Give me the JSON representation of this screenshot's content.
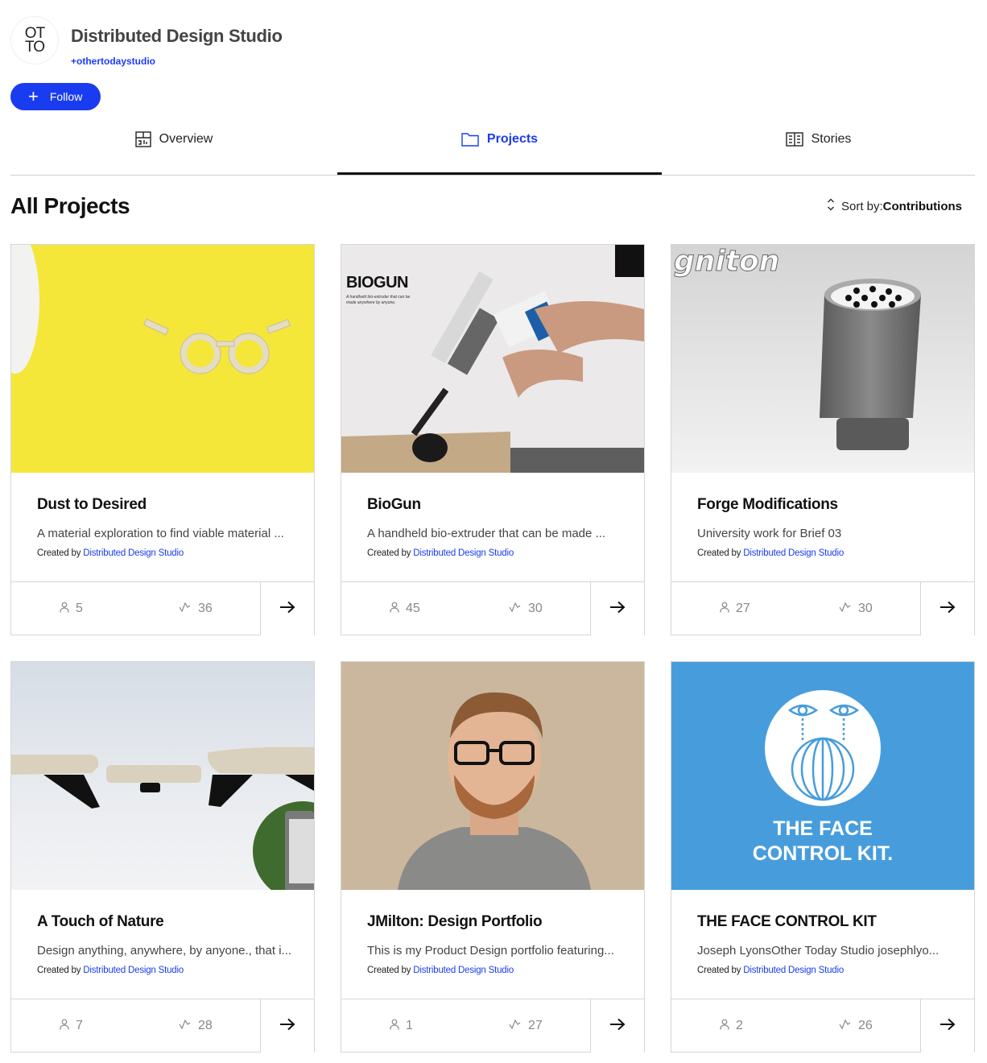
{
  "org": {
    "avatar_text": "OT\nTO",
    "name": "Distributed Design Studio",
    "handle": "+othertodaystudio",
    "follow_label": "Follow"
  },
  "tabs": [
    {
      "label": "Overview",
      "icon": "dashboard-icon",
      "active": false
    },
    {
      "label": "Projects",
      "icon": "folder-icon",
      "active": true
    },
    {
      "label": "Stories",
      "icon": "book-icon",
      "active": false
    }
  ],
  "section": {
    "title": "All Projects",
    "sort_prefix": "Sort by:",
    "sort_value": "Contributions"
  },
  "colors": {
    "accent": "#1a3cf0",
    "face_kit_blue": "#479ddc",
    "dust_yellow": "#f5e63a"
  },
  "projects": [
    {
      "title": "Dust to Desired",
      "description": "A material exploration to find viable material ...",
      "created_by_label": "Created by",
      "creator": "Distributed Design Studio",
      "members": "5",
      "contributions": "36",
      "image": "yellow-glasses-photo"
    },
    {
      "title": "BioGun",
      "description": "A handheld bio-extruder that can be made ...",
      "created_by_label": "Created by",
      "creator": "Distributed Design Studio",
      "members": "45",
      "contributions": "30",
      "image": "biogun-photo",
      "image_heading": "BIOGUN",
      "image_caption": "A handheld bio-extruder that can be made anywhere by anyone."
    },
    {
      "title": "Forge Modifications",
      "description": "University work for Brief 03",
      "created_by_label": "Created by",
      "creator": "Distributed Design Studio",
      "members": "27",
      "contributions": "30",
      "image": "gniton-render",
      "image_heading": "gniton"
    },
    {
      "title": "A Touch of Nature",
      "description": "Design anything, anywhere, by anyone., that i...",
      "created_by_label": "Created by",
      "creator": "Distributed Design Studio",
      "members": "7",
      "contributions": "28",
      "image": "modular-tables-photo"
    },
    {
      "title": "JMilton: Design Portfolio",
      "description": "This is my Product Design portfolio featuring...",
      "created_by_label": "Created by",
      "creator": "Distributed Design Studio",
      "members": "1",
      "contributions": "27",
      "image": "portrait-photo"
    },
    {
      "title": "THE FACE CONTROL KIT",
      "description": "Joseph LyonsOther Today Studio josephlyo...",
      "created_by_label": "Created by",
      "creator": "Distributed Design Studio",
      "members": "2",
      "contributions": "26",
      "image": "face-control-kit-poster",
      "image_heading_1": "THE FACE",
      "image_heading_2": "CONTROL KIT."
    }
  ]
}
